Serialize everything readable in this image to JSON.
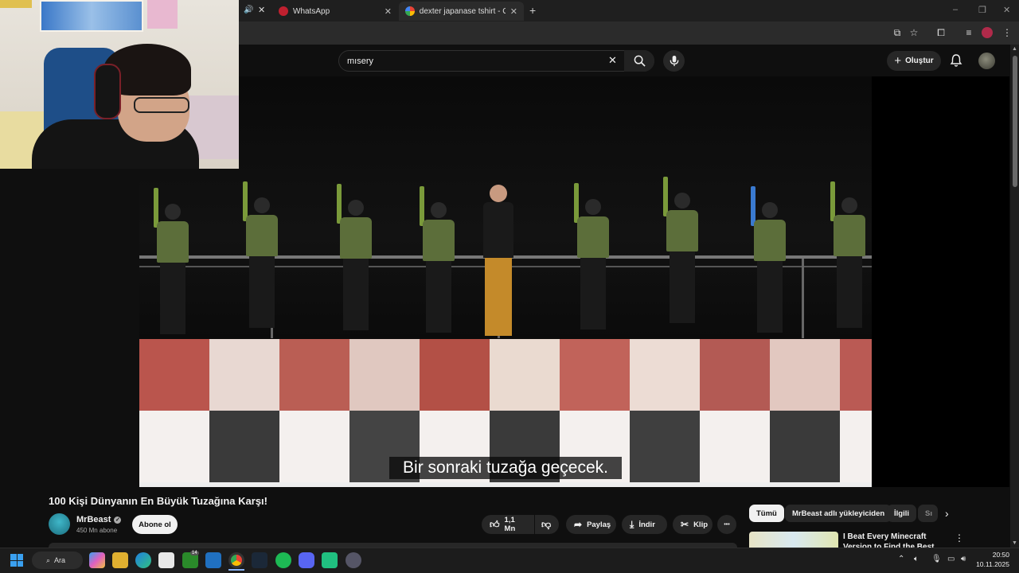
{
  "browser": {
    "tabs": [
      {
        "label": "WhatsApp",
        "icon": "whatsapp-icon"
      },
      {
        "label": "dexter japanase tshirt - Google",
        "icon": "google-icon"
      }
    ],
    "new_tab": "+"
  },
  "youtube": {
    "search": {
      "value": "mısery",
      "icon": "search-icon"
    },
    "create_label": "Oluştur"
  },
  "video": {
    "subtitle": "Bir sonraki tuzağa geçecek.",
    "title": "100 Kişi Dünyanın En Büyük Tuzağına Karşı!"
  },
  "channel": {
    "name": "MrBeast",
    "subscribers": "450 Mn abone",
    "subscribe_label": "Abone ol"
  },
  "actions": {
    "like_count": "1,1 Mn",
    "share_label": "Paylaş",
    "download_label": "İndir",
    "clip_label": "Klip",
    "more": "•••"
  },
  "chips": [
    "Tümü",
    "MrBeast adlı yükleyiciden",
    "İlgili",
    "Sı"
  ],
  "recommendation": {
    "title": "I Beat Every Minecraft Version to Find the Best One"
  },
  "taskbar": {
    "search_label": "Ara",
    "badge_count": "14",
    "time": "20:50",
    "date": "10.11.2025"
  },
  "colors": {
    "background": "#0f0f0f",
    "accent_red": "#cc2222",
    "chip_active": "#f1f1f1"
  }
}
